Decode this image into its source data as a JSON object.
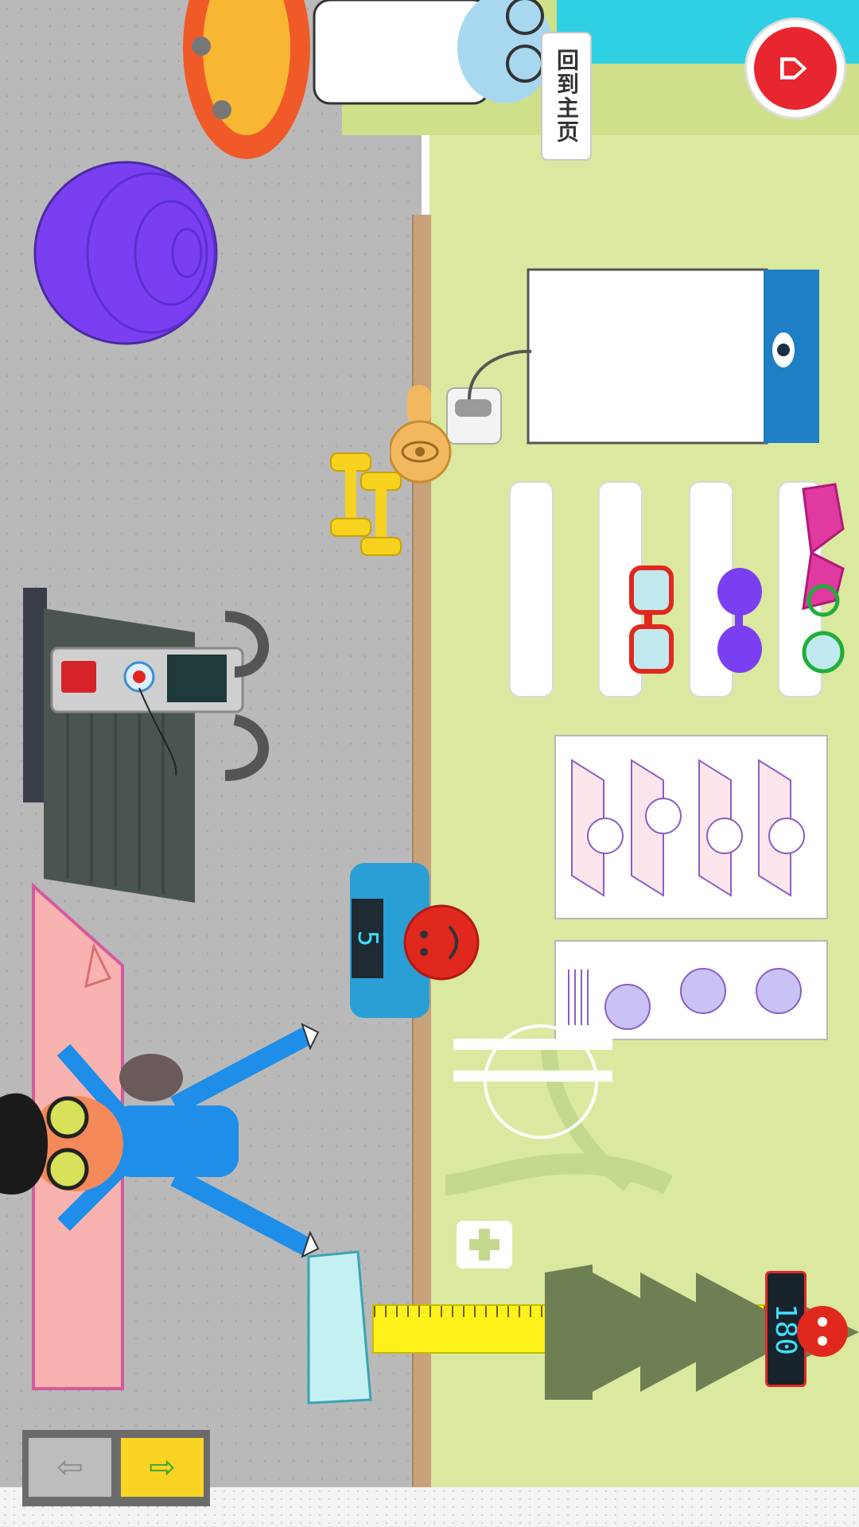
{
  "header": {
    "home_label": "回到主页",
    "home_icon": "home-icon"
  },
  "scale": {
    "reading": "5"
  },
  "height_meter": {
    "reading": "180"
  },
  "navigation": {
    "prev_icon": "arrow-left-icon",
    "next_icon": "arrow-right-icon"
  },
  "colors": {
    "home_button": "#e8262f",
    "next_button": "#f9d423",
    "exercise_ball": "#7b3ff2",
    "shirt": "#1e8ee8"
  }
}
